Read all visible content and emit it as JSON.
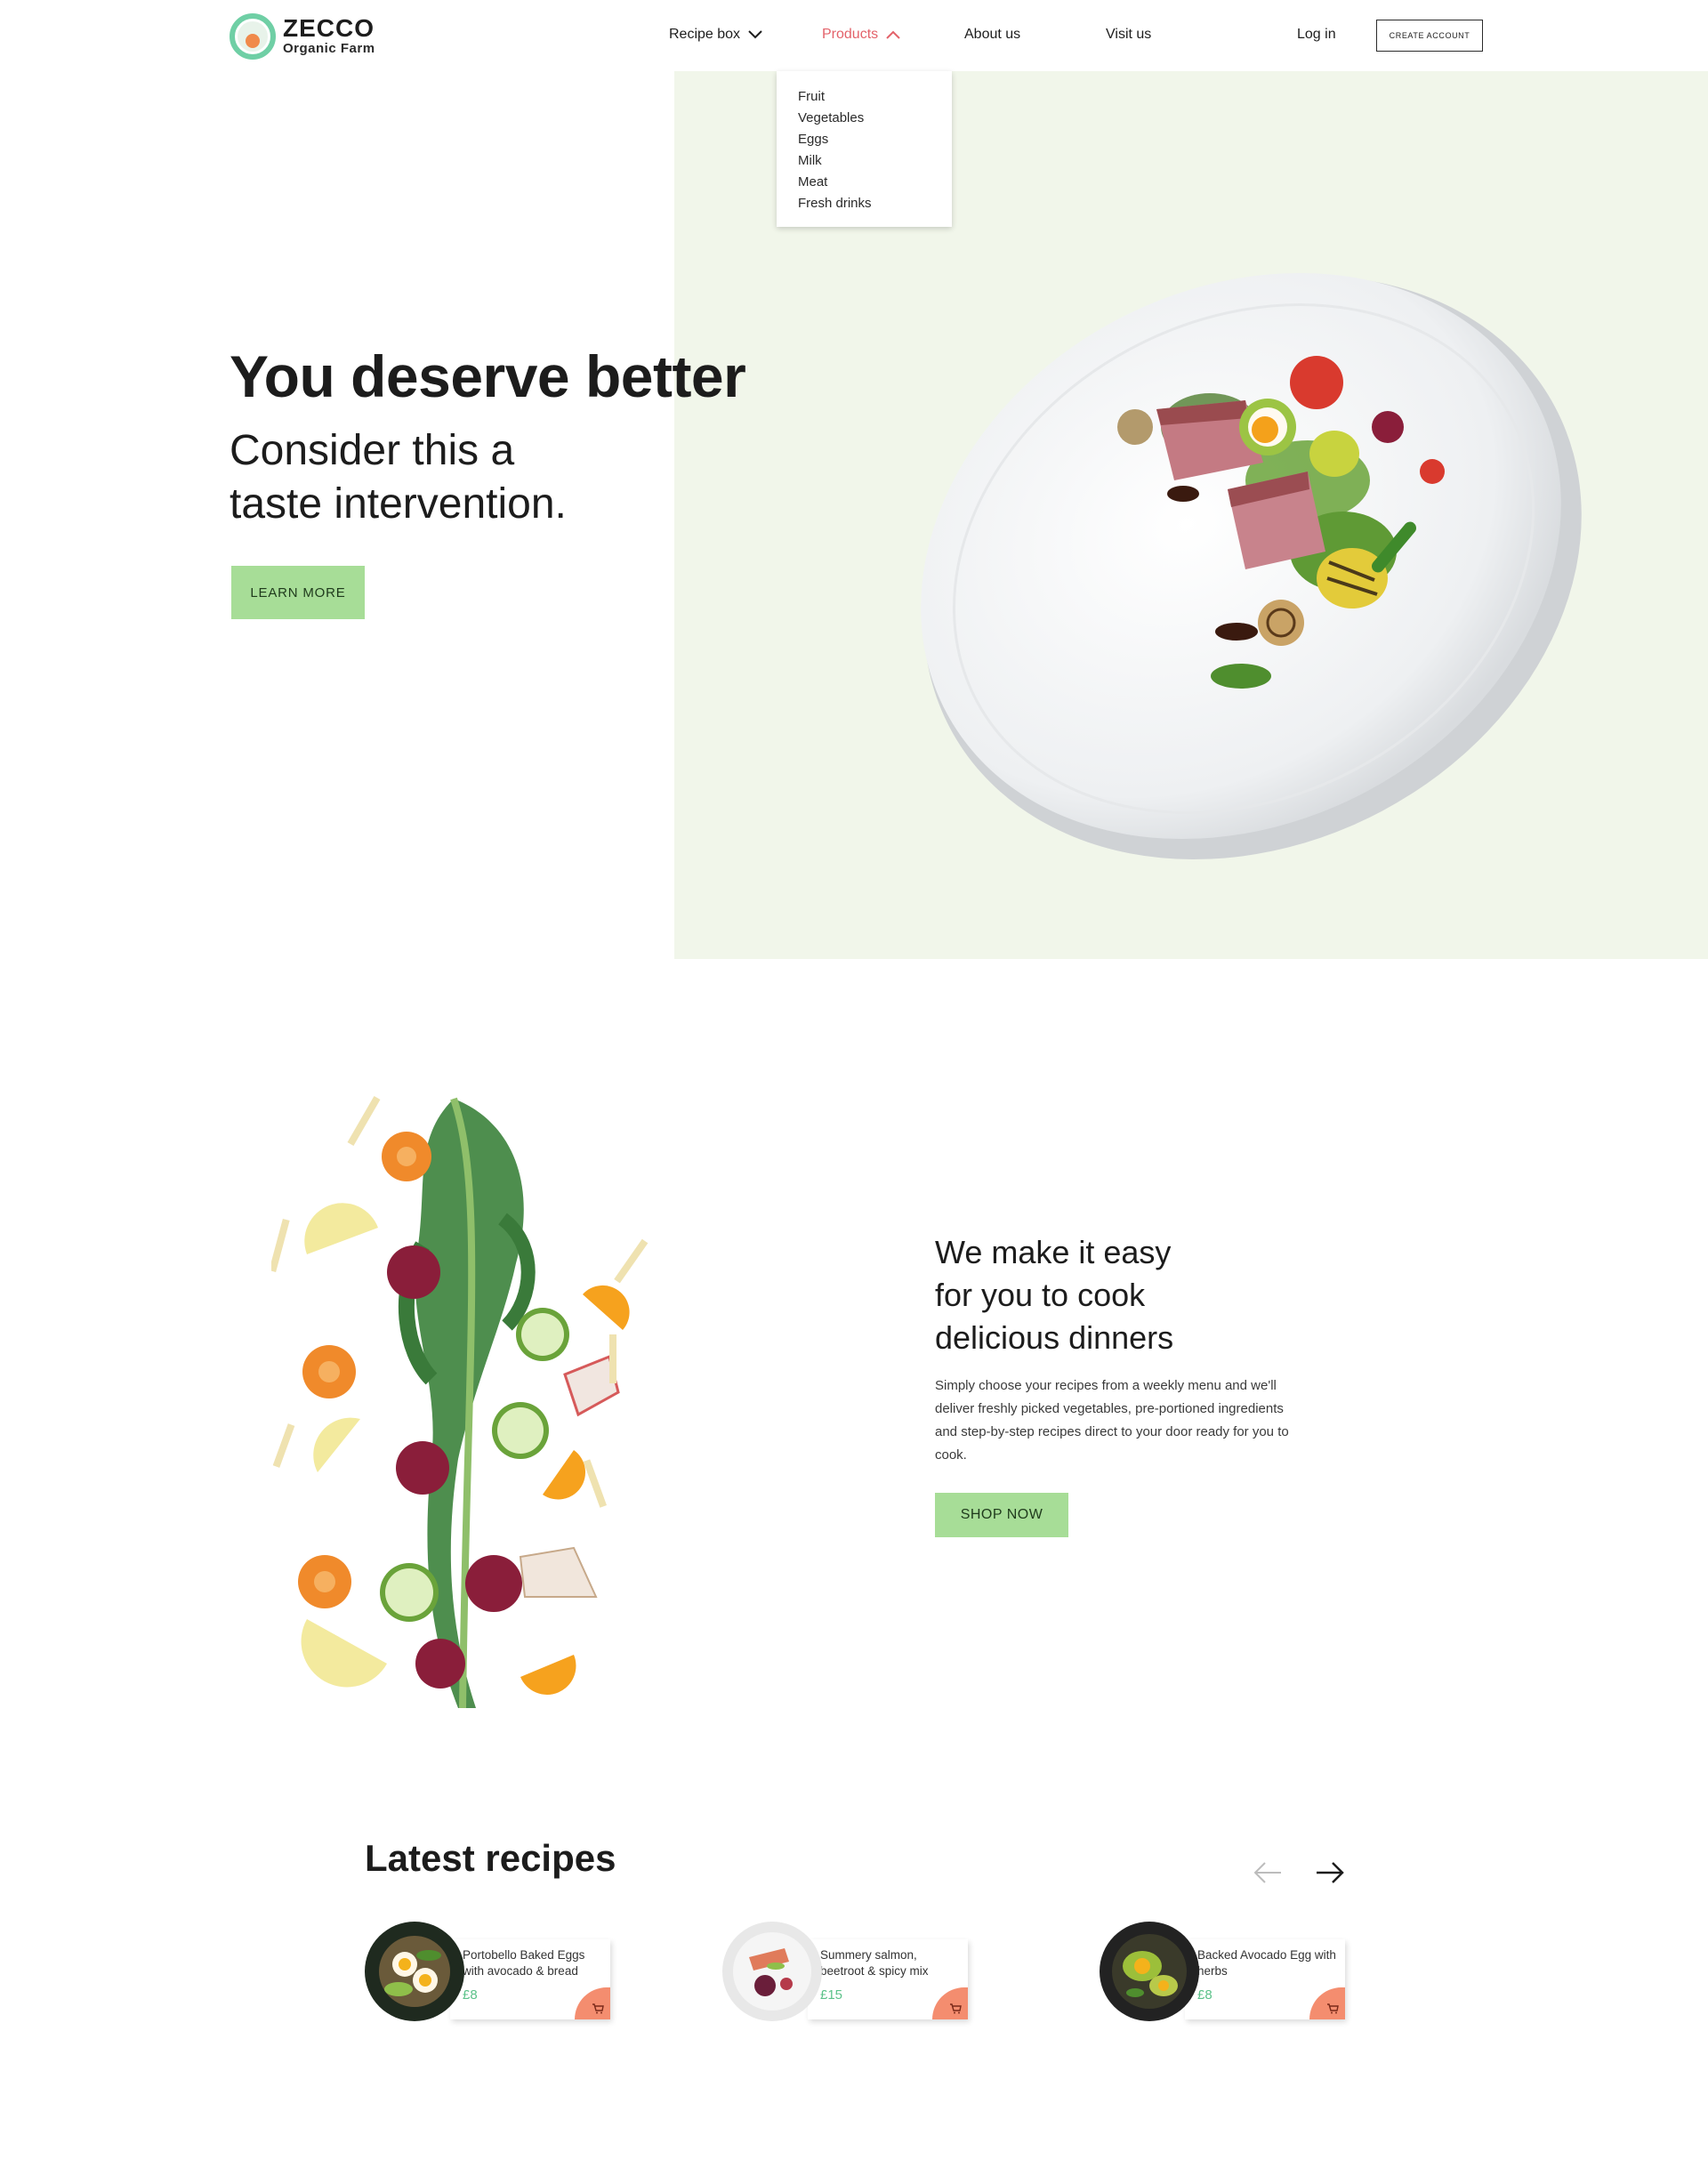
{
  "brand": {
    "name": "ZECCO",
    "tagline": "Organic Farm"
  },
  "nav": {
    "recipe_box": "Recipe box",
    "products": "Products",
    "about": "About us",
    "visit": "Visit us",
    "login": "Log in",
    "create_account": "CREATE ACCOUNT"
  },
  "products_menu": [
    "Fruit",
    "Vegetables",
    "Eggs",
    "Milk",
    "Meat",
    "Fresh drinks"
  ],
  "hero": {
    "title": "You deserve better",
    "subtitle_line1": "Consider this a",
    "subtitle_line2": "taste intervention.",
    "cta": "LEARN MORE"
  },
  "feature": {
    "title_line1": "We make it easy",
    "title_line2": "for you to cook",
    "title_line3": "delicious dinners",
    "body": "Simply choose your recipes from a weekly menu and we'll deliver freshly picked vegetables,  pre-portioned ingredients and step-by-step recipes direct to your door ready for you to cook.",
    "cta": "SHOP NOW"
  },
  "recipes": {
    "title": "Latest recipes",
    "items": [
      {
        "name": "Portobello Baked Eggs with avocado & bread",
        "price": "£8"
      },
      {
        "name": "Summery salmon, beetroot & spicy mix",
        "price": "£15"
      },
      {
        "name": "Backed Avocado Egg with herbs",
        "price": "£8"
      }
    ]
  },
  "colors": {
    "accent_green": "#a7dd97",
    "hero_bg": "#f1f6ea",
    "active_nav": "#e3626a",
    "price": "#5cc28a",
    "cart": "#f48d6f",
    "logo_ring": "#6fcfa5"
  }
}
